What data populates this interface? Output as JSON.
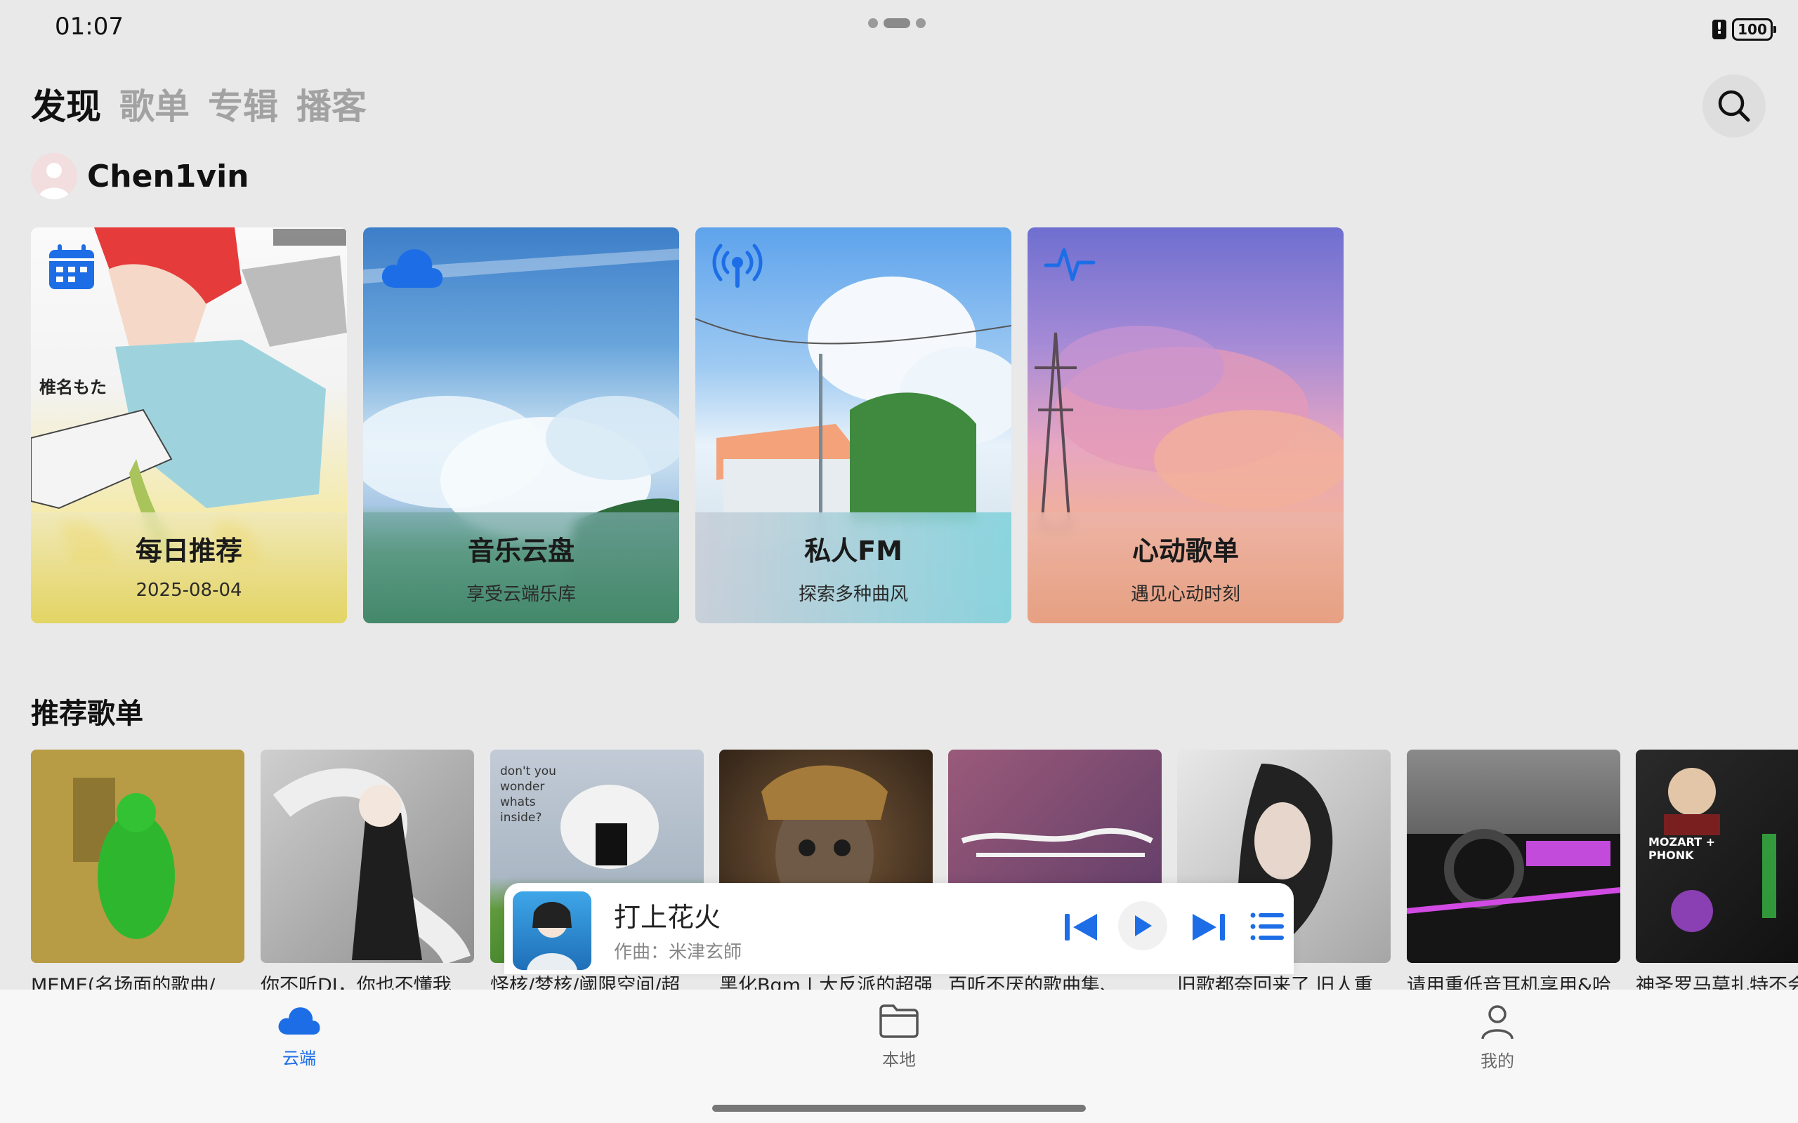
{
  "status_bar": {
    "time": "01:07",
    "battery": "100"
  },
  "top_tabs": [
    {
      "label": "发现",
      "active": true
    },
    {
      "label": "歌单",
      "active": false
    },
    {
      "label": "专辑",
      "active": false
    },
    {
      "label": "播客",
      "active": false
    }
  ],
  "user": {
    "name": "Chen1vin"
  },
  "feature_cards": [
    {
      "title": "每日推荐",
      "subtitle": "2025-08-04",
      "icon": "calendar-icon",
      "art_text": "椎名もた"
    },
    {
      "title": "音乐云盘",
      "subtitle": "享受云端乐库",
      "icon": "cloud-icon"
    },
    {
      "title": "私人FM",
      "subtitle": "探索多种曲风",
      "icon": "radio-icon"
    },
    {
      "title": "心动歌单",
      "subtitle": "遇见心动时刻",
      "icon": "heartbeat-icon"
    }
  ],
  "section": {
    "title": "推荐歌单"
  },
  "playlists": [
    {
      "name": "MEME(名场面的歌曲/"
    },
    {
      "name": "你不听DJ，你也不懂我"
    },
    {
      "name": "怪核/梦核/阈限空间/超",
      "art_text": "don't you wonder whats inside?"
    },
    {
      "name": "黑化Bgm | 大反派的超强"
    },
    {
      "name": "百听不厌的歌曲集、"
    },
    {
      "name": "旧歌都奈回来了 旧人重"
    },
    {
      "name": "请用重低音耳机享用&哈"
    },
    {
      "name": "神圣罗马莫扎特不会",
      "art_text": "MOZART + PHONK"
    }
  ],
  "mini_player": {
    "title": "打上花火",
    "artist": "作曲：米津玄師"
  },
  "bottom_nav": [
    {
      "label": "云端",
      "icon": "cloud-icon",
      "active": true
    },
    {
      "label": "本地",
      "icon": "folder-icon",
      "active": false
    },
    {
      "label": "我的",
      "icon": "person-icon",
      "active": false
    }
  ],
  "colors": {
    "accent": "#1d6ee6",
    "background": "#e9e9e9"
  }
}
